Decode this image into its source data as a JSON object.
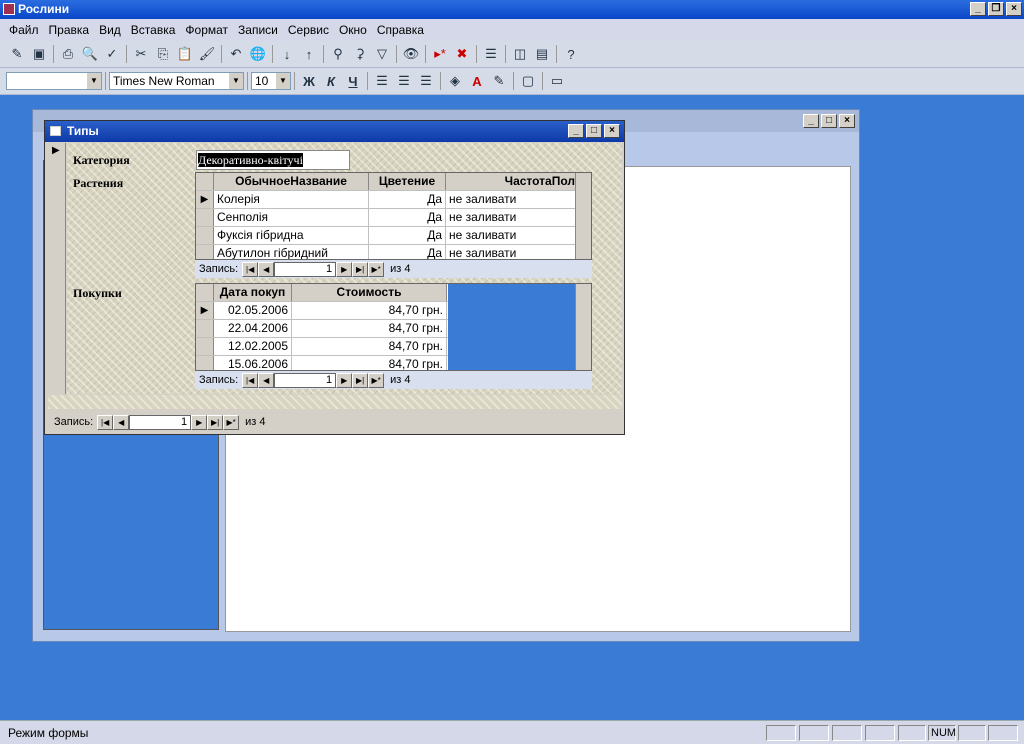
{
  "app": {
    "title": "Рослини"
  },
  "menu": [
    "Файл",
    "Правка",
    "Вид",
    "Вставка",
    "Формат",
    "Записи",
    "Сервис",
    "Окно",
    "Справка"
  ],
  "format_toolbar": {
    "style_value": "",
    "font_value": "Times New Roman",
    "size_value": "10",
    "bold": "Ж",
    "italic": "К",
    "underline": "Ч"
  },
  "form": {
    "title": "Типы",
    "category_label": "Категория",
    "category_value": "Декоративно-квітучі",
    "plants_label": "Растения",
    "purchases_label": "Покупки"
  },
  "plants_grid": {
    "columns": [
      "ОбычноеНазвание",
      "Цветение",
      "ЧастотаПол"
    ],
    "rows": [
      {
        "name": "Колерія",
        "bloom": "Да",
        "freq": "не заливати"
      },
      {
        "name": "Сенполія",
        "bloom": "Да",
        "freq": "не заливати"
      },
      {
        "name": "Фуксія гібридна",
        "bloom": "Да",
        "freq": "не заливати"
      },
      {
        "name": "Абутилон гібридний",
        "bloom": "Да",
        "freq": "не заливати"
      }
    ],
    "nav": {
      "label": "Запись:",
      "current": "1",
      "of": "из 4"
    }
  },
  "purchases_grid": {
    "columns": [
      "Дата покуп",
      "Стоимость"
    ],
    "rows": [
      {
        "date": "02.05.2006",
        "cost": "84,70 грн."
      },
      {
        "date": "22.04.2006",
        "cost": "84,70 грн."
      },
      {
        "date": "12.02.2005",
        "cost": "84,70 грн."
      },
      {
        "date": "15.06.2006",
        "cost": "84,70 грн."
      }
    ],
    "nav": {
      "label": "Запись:",
      "current": "1",
      "of": "из 4"
    }
  },
  "form_nav": {
    "label": "Запись:",
    "current": "1",
    "of": "из 4"
  },
  "status": {
    "text": "Режим формы",
    "num": "NUM"
  }
}
